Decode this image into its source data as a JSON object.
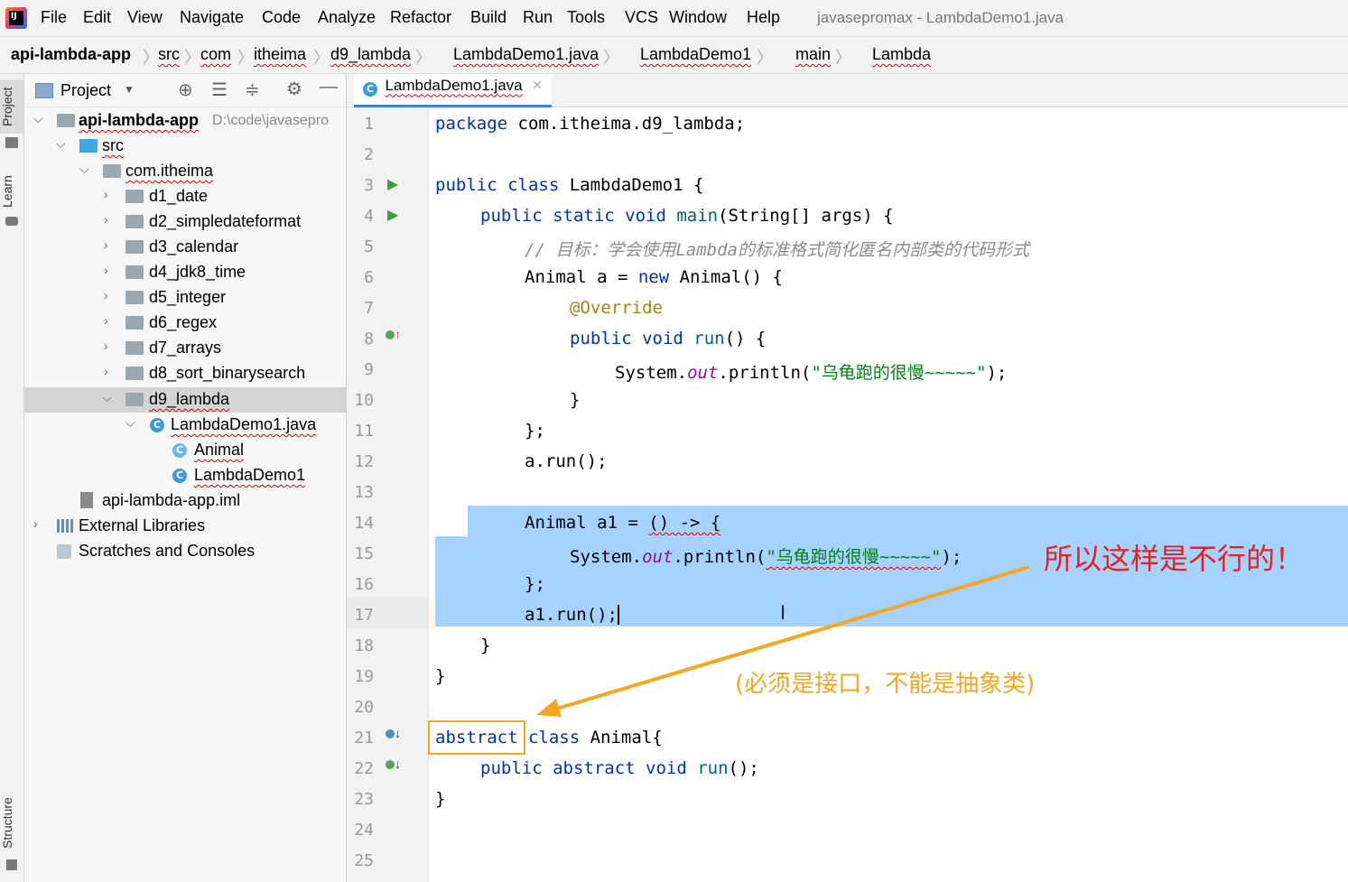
{
  "menu": {
    "logo": "IJ",
    "items": [
      "File",
      "Edit",
      "View",
      "Navigate",
      "Code",
      "Analyze",
      "Refactor",
      "Build",
      "Run",
      "Tools",
      "VCS",
      "Window",
      "Help"
    ],
    "window_title": "javasepromax - LambdaDemo1.java"
  },
  "breadcrumb": [
    "api-lambda-app",
    "src",
    "com",
    "itheima",
    "d9_lambda",
    "LambdaDemo1.java",
    "LambdaDemo1",
    "main",
    "Lambda"
  ],
  "side_tabs": {
    "project": "Project",
    "learn": "Learn",
    "structure": "Structure"
  },
  "project_panel": {
    "title": "Project",
    "root": {
      "name": "api-lambda-app",
      "path": "D:\\code\\javasepro"
    },
    "src": "src",
    "package": "com.itheima",
    "folders": [
      "d1_date",
      "d2_simpledateformat",
      "d3_calendar",
      "d4_jdk8_time",
      "d5_integer",
      "d6_regex",
      "d7_arrays",
      "d8_sort_binarysearch",
      "d9_lambda"
    ],
    "file": "LambdaDemo1.java",
    "classes": [
      "Animal",
      "LambdaDemo1"
    ],
    "iml": "api-lambda-app.iml",
    "external": "External Libraries",
    "scratches": "Scratches and Consoles"
  },
  "editor": {
    "tab": "LambdaDemo1.java",
    "line_numbers": [
      "1",
      "2",
      "3",
      "4",
      "5",
      "6",
      "7",
      "8",
      "9",
      "10",
      "11",
      "12",
      "13",
      "14",
      "15",
      "16",
      "17",
      "18",
      "19",
      "20",
      "21",
      "22",
      "23",
      "24",
      "25"
    ],
    "code": {
      "l1": [
        "package",
        " com.itheima.d9_lambda;"
      ],
      "l3": [
        "public class",
        " LambdaDemo1 {"
      ],
      "l4": [
        "public static void ",
        "main",
        "(String[] args) {"
      ],
      "l5": "// 目标：学会使用Lambda的标准格式简化匿名内部类的代码形式",
      "l6": [
        "Animal a = ",
        "new",
        " Animal() {"
      ],
      "l7": "@Override",
      "l8": [
        "public void ",
        "run",
        "() {"
      ],
      "l9": [
        "System.",
        "out",
        ".println(",
        "\"乌龟跑的很慢~~~~~\"",
        ");"
      ],
      "l10": "}",
      "l11": "};",
      "l12": "a.run();",
      "l14": [
        "Animal a1 = ",
        "() -> {"
      ],
      "l15": [
        "System.",
        "out",
        ".println(",
        "\"乌龟跑的很慢~~~~~\"",
        ");"
      ],
      "l16": "};",
      "l17": "a1.run();",
      "l18": "}",
      "l19": "}",
      "l21": [
        "abstract",
        " class",
        " Animal{"
      ],
      "l22": [
        "public abstract void ",
        "run",
        "();"
      ],
      "l23": "}"
    }
  },
  "annotations": {
    "red_note": "所以这样是不行的！",
    "orange_note": "(必须是接口，不能是抽象类)"
  }
}
